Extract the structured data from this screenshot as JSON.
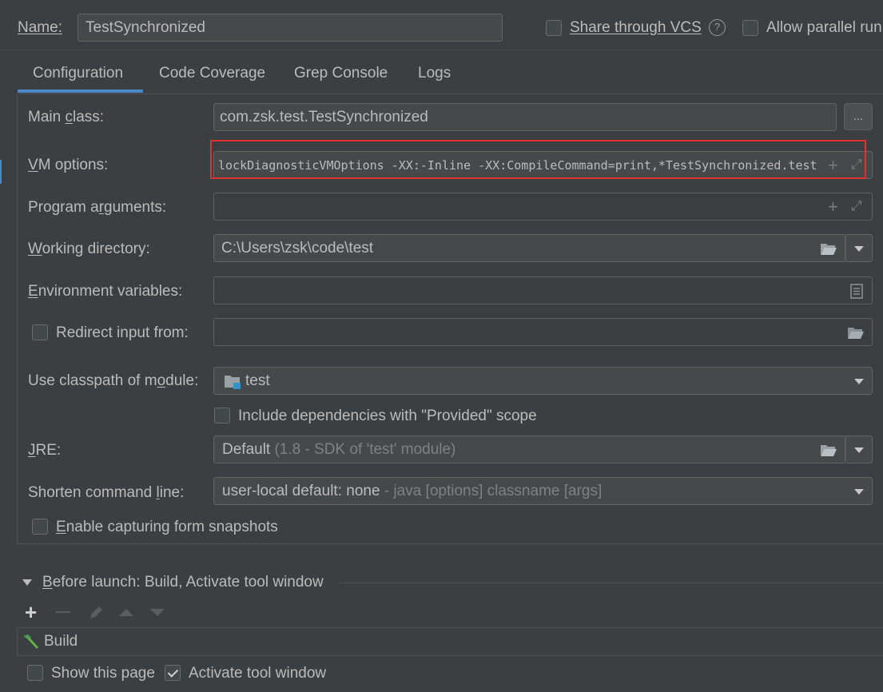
{
  "header": {
    "name_label": "Name:",
    "name_value": "TestSynchronized",
    "share_vcs_label": "Share through VCS",
    "help_glyph": "?",
    "allow_parallel_label": "Allow parallel run"
  },
  "tabs": [
    {
      "label": "Configuration",
      "active": true
    },
    {
      "label": "Code Coverage",
      "active": false
    },
    {
      "label": "Grep Console",
      "active": false
    },
    {
      "label": "Logs",
      "active": false
    }
  ],
  "form": {
    "main_class_label": "Main class:",
    "main_class_value": "com.zsk.test.TestSynchronized",
    "browse_label": "...",
    "vm_options_label": "VM options:",
    "vm_options_value": "lockDiagnosticVMOptions -XX:-Inline -XX:CompileCommand=print,*TestSynchronized.test",
    "program_args_label": "Program arguments:",
    "program_args_value": "",
    "working_dir_label": "Working directory:",
    "working_dir_value": "C:\\Users\\zsk\\code\\test",
    "env_vars_label": "Environment variables:",
    "env_vars_value": "",
    "redirect_input_label": "Redirect input from:",
    "redirect_input_value": "",
    "classpath_label": "Use classpath of module:",
    "classpath_value": "test",
    "include_deps_label": "Include dependencies with \"Provided\" scope",
    "jre_label": "JRE:",
    "jre_value": "Default",
    "jre_hint": "(1.8 - SDK of 'test' module)",
    "shorten_label": "Shorten command line:",
    "shorten_value": "user-local default: none",
    "shorten_hint": "- java [options] classname [args]",
    "snapshots_label": "Enable capturing form snapshots"
  },
  "before_launch": {
    "title": "Before launch: Build, Activate tool window",
    "items": [
      {
        "label": "Build",
        "icon": "hammer-icon"
      }
    ],
    "show_page_label": "Show this page",
    "activate_tool_label": "Activate tool window"
  },
  "colors": {
    "background": "#3c3f41",
    "field": "#45494a",
    "accent": "#4a88c7",
    "highlight_box": "#e03030"
  }
}
